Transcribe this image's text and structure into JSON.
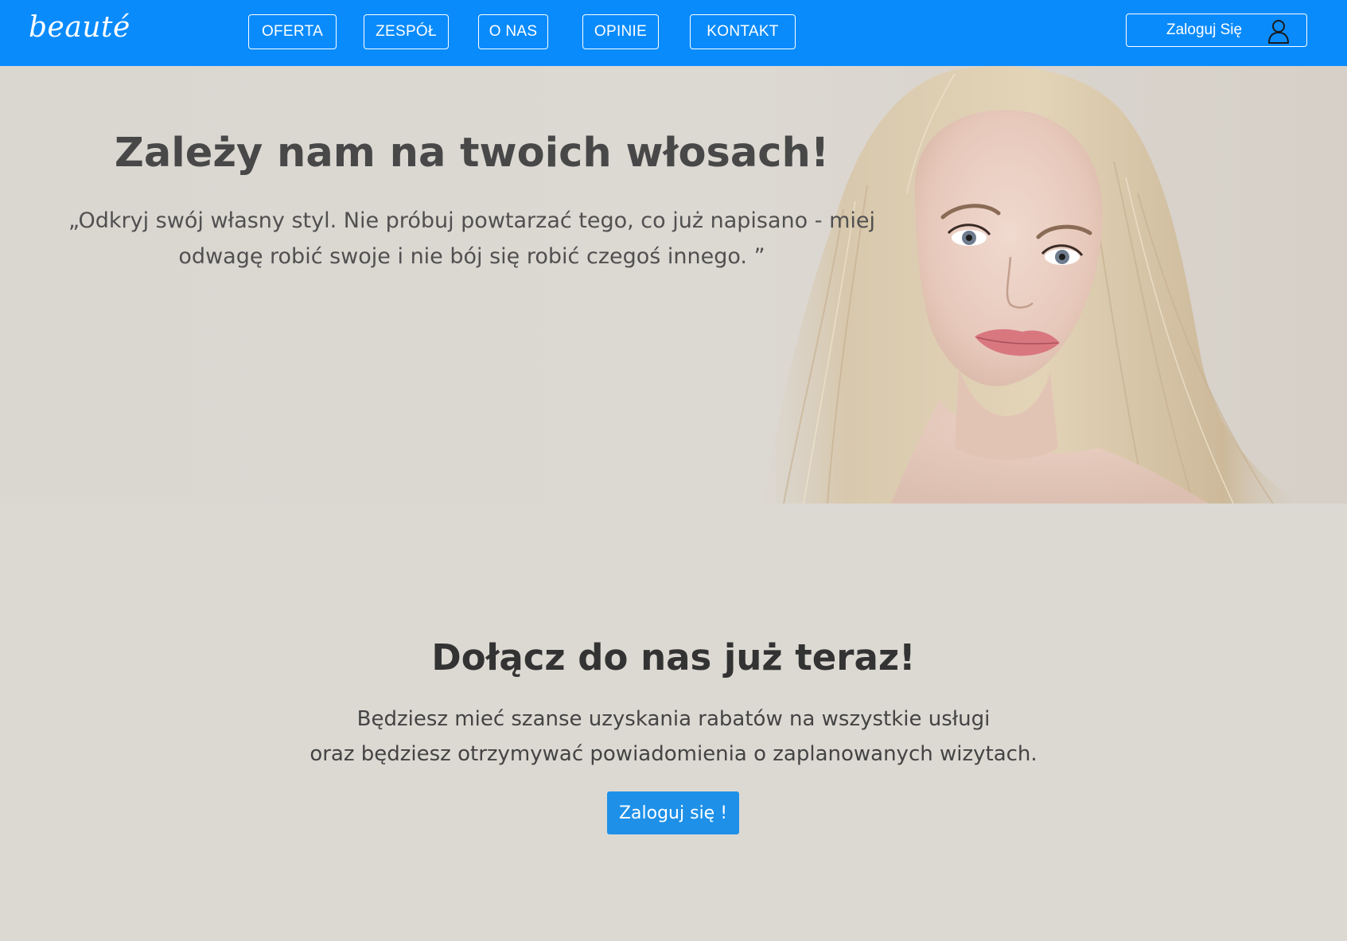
{
  "navbar": {
    "logo": "beauté",
    "items": [
      {
        "label": "OFERTA"
      },
      {
        "label": "ZESPÓŁ"
      },
      {
        "label": "O NAS"
      },
      {
        "label": "OPINIE"
      },
      {
        "label": "KONTAKT"
      }
    ],
    "login_label": "Zaloguj Się",
    "login_icon": "user-icon"
  },
  "hero": {
    "title": "Zależy nam na twoich włosach!",
    "quote_line1": "„Odkryj swój własny styl. Nie próbuj powtarzać tego, co już napisano - miej",
    "quote_line2": "odwagę robić swoje i nie bój się robić czegoś innego. ”"
  },
  "join": {
    "title": "Dołącz do nas już teraz!",
    "text_line1": "Będziesz mieć szanse uzyskania rabatów na wszystkie usługi",
    "text_line2": "oraz będziesz otrzymywać powiadomienia o zaplanowanych wizytach.",
    "button_label": "Zaloguj się !"
  },
  "colors": {
    "navbar": "#0a8bfc",
    "background": "#dcd9d3",
    "cta": "#1e90e8"
  }
}
